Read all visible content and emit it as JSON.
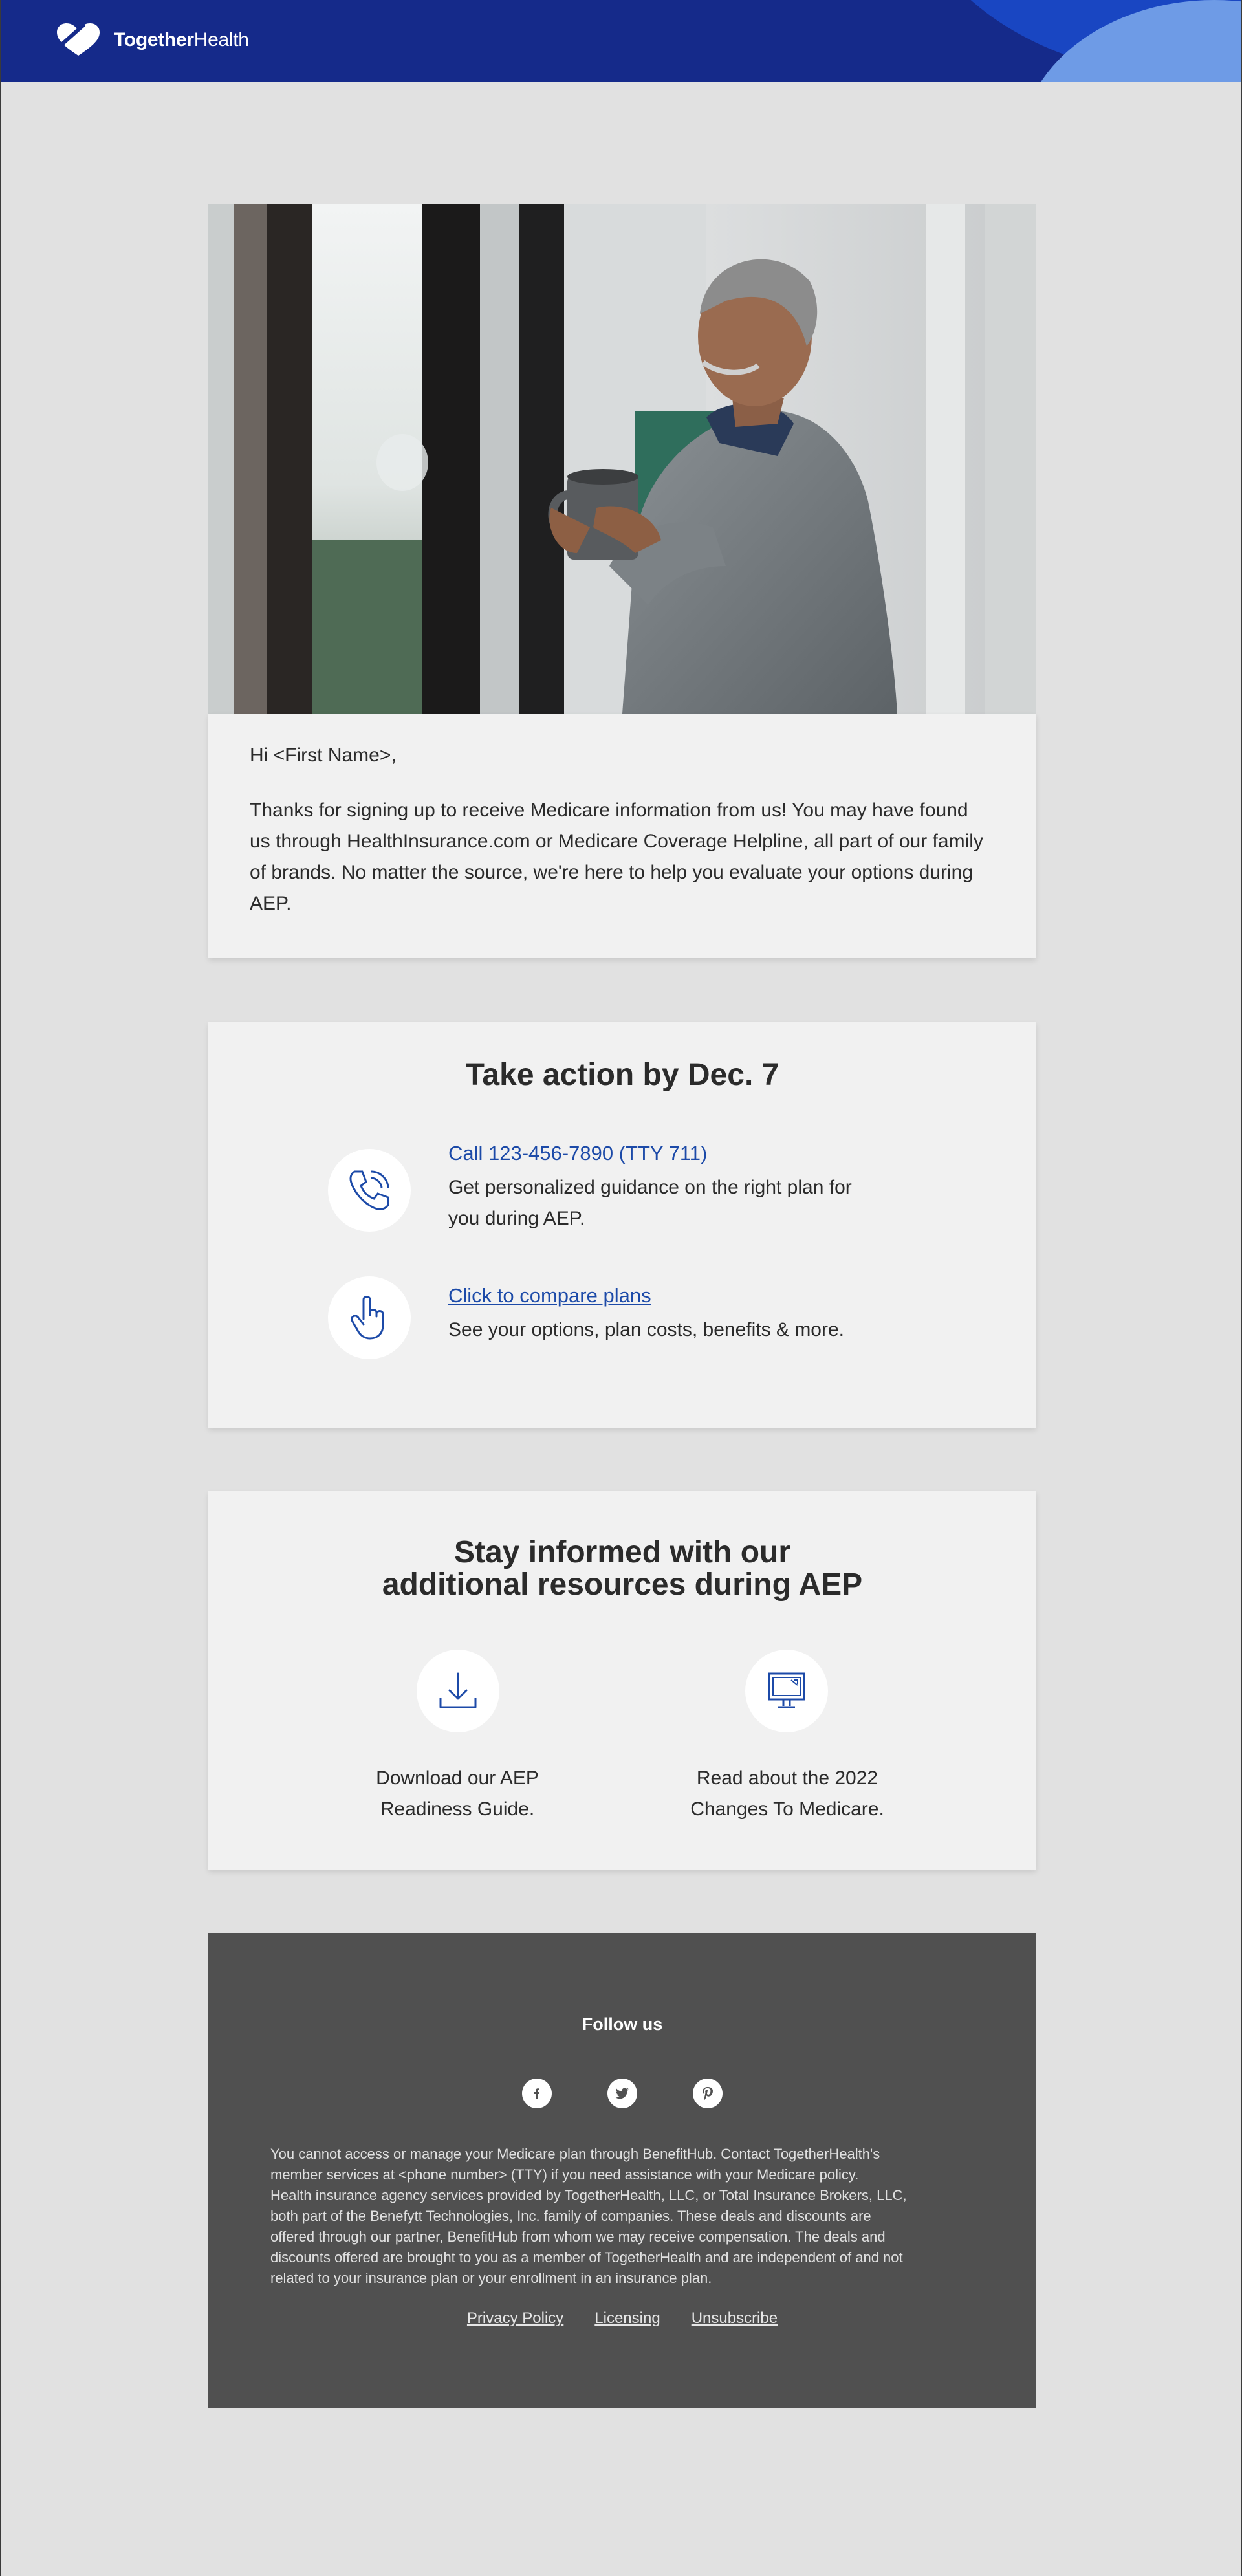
{
  "brand": {
    "name_bold": "Together",
    "name_regular": "Health",
    "primary_color": "#152a8a",
    "accent_color": "#1c4aa8"
  },
  "intro_card": {
    "greeting": "Hi <First Name>,",
    "body": "Thanks for signing up to receive Medicare information from us! You may have found us through HealthInsurance.com or Medicare Coverage Helpline, all part of our family of brands. No matter the source, we're here to help you evaluate your options during AEP."
  },
  "action_card": {
    "title": "Take action by Dec. 7",
    "items": [
      {
        "icon": "phone-icon",
        "link": "Call 123-456-7890 (TTY 711)",
        "desc_line1": "Get personalized guidance on the right plan for",
        "desc_line2": "you during AEP."
      },
      {
        "icon": "hand-pointer-icon",
        "link": "Click to compare plans",
        "desc_line1": "See your options, plan costs, benefits & more."
      }
    ]
  },
  "resources_card": {
    "title_line1": "Stay informed with our",
    "title_line2": "additional resources during AEP",
    "items": [
      {
        "icon": "download-icon",
        "line1": "Download our AEP",
        "line2": "Readiness Guide."
      },
      {
        "icon": "monitor-icon",
        "line1": "Read about the 2022",
        "line2": "Changes To Medicare."
      }
    ]
  },
  "footer": {
    "follow_label": "Follow us",
    "social": [
      "facebook-icon",
      "twitter-icon",
      "pinterest-icon"
    ],
    "disclaimer_lines": [
      "You cannot access or manage your Medicare plan through BenefitHub.  Contact TogetherHealth's",
      "member services at <phone number> (TTY) if you need assistance with your Medicare policy.",
      "Health insurance agency services provided by TogetherHealth, LLC, or Total Insurance Brokers, LLC,",
      "both part of the Benefytt Technologies, Inc. family of companies. These deals and discounts are",
      "offered through our partner, BenefitHub from whom we may receive compensation. The deals and",
      "discounts offered are brought to you as a member of TogetherHealth and are independent of and not",
      "related to your insurance plan or your enrollment in an insurance plan."
    ],
    "links": [
      "Privacy Policy",
      "Licensing",
      "Unsubscribe"
    ]
  }
}
